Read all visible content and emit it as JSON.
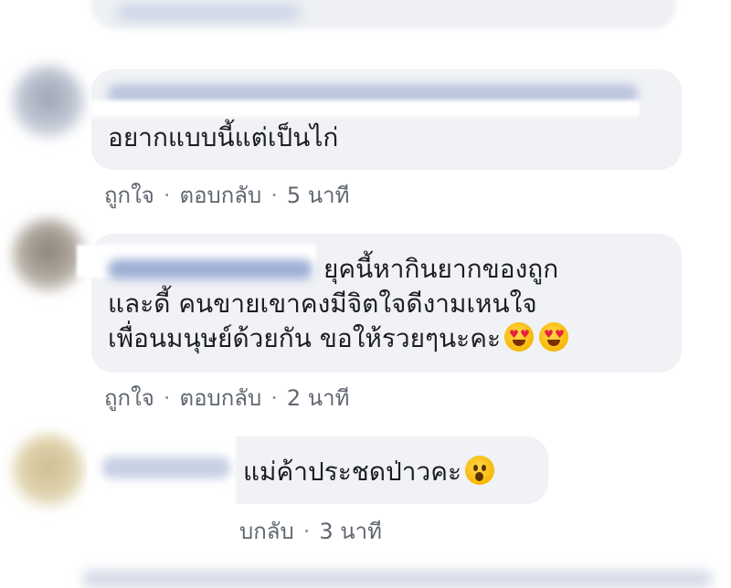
{
  "comments": [
    {
      "text_lines": [
        "อยากแบบนี้แต่เป็นไก่"
      ],
      "actions": {
        "like": "ถูกใจ",
        "reply": "ตอบกลับ",
        "time": "5 นาที"
      }
    },
    {
      "text_lines": [
        "ยุคนี้หากินยากของถูก",
        "และดี้ คนขายเขาคงมีจิตใจดีงามเหนใจ",
        "เพื่อนมนุษย์ด้วยกัน ขอให้รวยๆนะคะ"
      ],
      "emoji": [
        "heart-eyes",
        "heart-eyes"
      ],
      "actions": {
        "like": "ถูกใจ",
        "reply": "ตอบกลับ",
        "time": "2 นาที"
      }
    },
    {
      "text_lines": [
        "แม่ค้าประชดป่าวคะ"
      ],
      "emoji": [
        "surprised"
      ],
      "actions": {
        "reply": "บกลับ",
        "time": "3 นาที"
      }
    }
  ],
  "colors": {
    "bubble": "#f0f2f5",
    "link": "#606770",
    "text": "#1c1e21"
  }
}
